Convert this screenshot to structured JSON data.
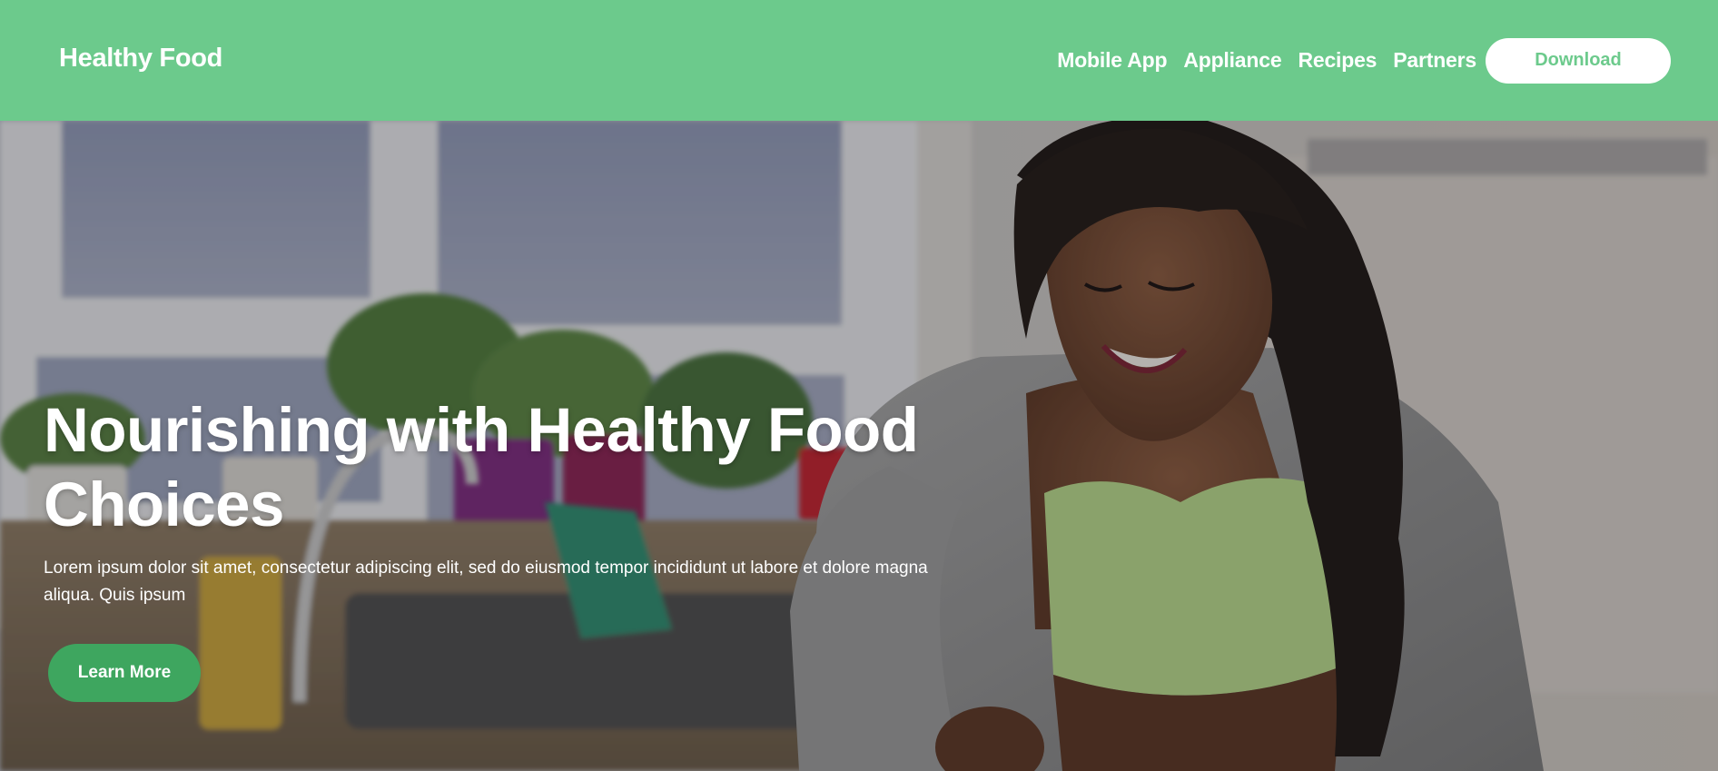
{
  "header": {
    "brand": "Healthy Food",
    "nav": [
      {
        "label": "Mobile App"
      },
      {
        "label": "Appliance"
      },
      {
        "label": "Recipes"
      },
      {
        "label": "Partners"
      }
    ],
    "download_label": "Download"
  },
  "hero": {
    "title": "Nourishing with Healthy Food Choices",
    "text": "Lorem ipsum dolor sit amet, consectetur adipiscing elit, sed do eiusmod tempor incididunt ut labore et dolore magna aliqua. Quis ipsum",
    "button_label": "Learn More"
  },
  "colors": {
    "header_bg": "#6cca8c",
    "primary_button": "#3ea65f",
    "download_text": "#6cca8c"
  }
}
